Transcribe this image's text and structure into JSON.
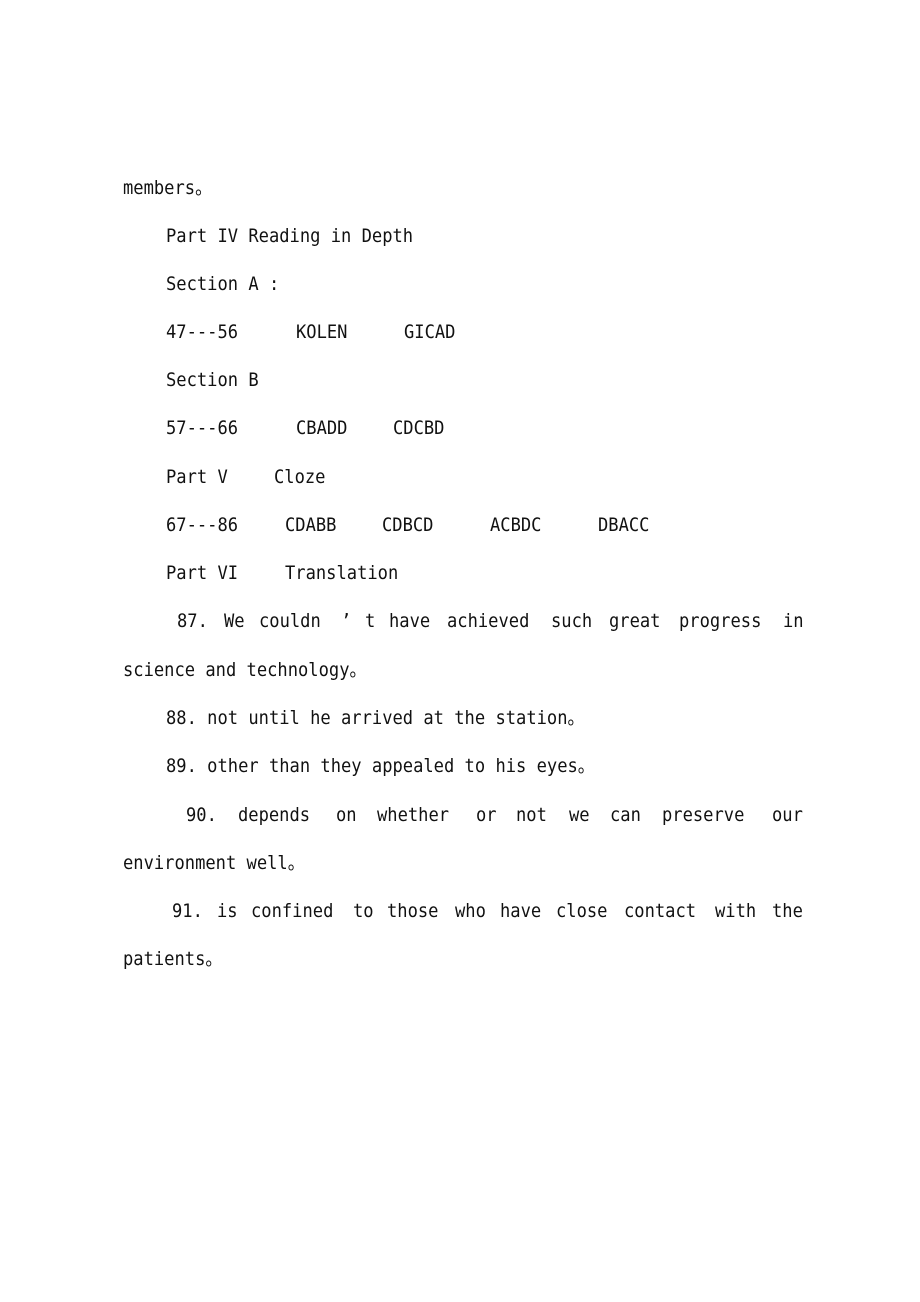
{
  "document": {
    "continuation": "members。",
    "part4_heading": "Part IV Reading in Depth",
    "section_a": {
      "label": "Section A :",
      "range": "47---56",
      "answers": [
        "KOLEN",
        "GICAD"
      ]
    },
    "section_b": {
      "label": "Section B",
      "range": "57---66",
      "answers": [
        "CBADD",
        "CDCBD"
      ]
    },
    "part5": {
      "label": "Part V",
      "title": "Cloze",
      "range": "67---86",
      "answers": [
        "CDABB",
        "CDBCD",
        "ACBDC",
        "DBACC"
      ]
    },
    "part6": {
      "label": "Part VI",
      "title": "Translation"
    },
    "translations": {
      "t87_words": [
        "87.",
        "We",
        "couldn",
        "’",
        "t",
        "have",
        "achieved",
        "such",
        "great",
        "progress",
        "in"
      ],
      "t87_cont": "science and technology。",
      "t88": "88. not until he arrived at the station。",
      "t89": "89. other than they appealed to his eyes。",
      "t90_words": [
        "90.",
        "depends",
        "on",
        "whether",
        "or",
        "not",
        "we",
        "can",
        "preserve",
        "our"
      ],
      "t90_cont": "environment well。",
      "t91_words": [
        "91.",
        "is",
        "confined",
        "to",
        "those",
        "who",
        "have",
        "close",
        "contact",
        "with",
        "the"
      ],
      "t91_cont": "patients。"
    }
  }
}
